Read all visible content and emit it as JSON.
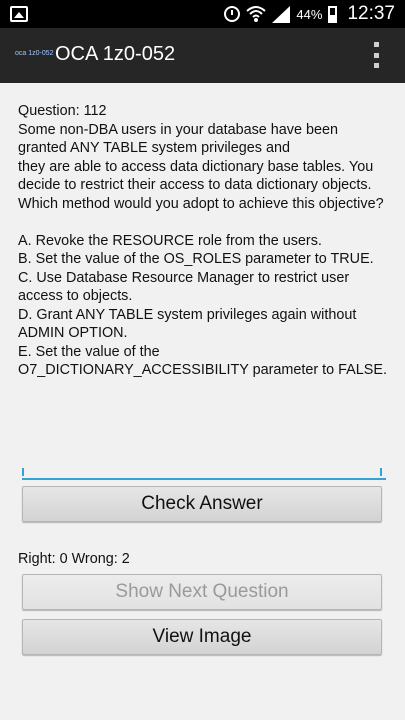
{
  "status_bar": {
    "battery": "44%",
    "time": "12:37",
    "icons": [
      "gallery-icon",
      "alarm-icon",
      "wifi-icon",
      "signal-icon",
      "battery-icon"
    ]
  },
  "app_bar": {
    "logo_text": "oca 1z0-052",
    "title": "OCA 1z0-052"
  },
  "question": {
    "text": "Question: 112\nSome non-DBA users in your database have been granted ANY TABLE system privileges and\nthey are able to access data dictionary base tables. You decide to restrict their access to data dictionary objects. Which method would you adopt to achieve this objective?\n\nA. Revoke the RESOURCE role from the users.\nB. Set the value of the OS_ROLES parameter to TRUE.\nC. Use Database Resource Manager to restrict user access to objects.\nD. Grant ANY TABLE system privileges again without ADMIN OPTION.\nE. Set the value of the O7_DICTIONARY_ACCESSIBILITY parameter to FALSE."
  },
  "answer_input": {
    "value": "",
    "placeholder": ""
  },
  "buttons": {
    "check_answer": "Check Answer",
    "show_next": "Show Next Question",
    "view_image": "View Image"
  },
  "score": {
    "text": "Right: 0 Wrong: 2"
  },
  "colors": {
    "accent": "#33a3d6",
    "app_bar": "#262626",
    "background": "#f1f1f1"
  }
}
